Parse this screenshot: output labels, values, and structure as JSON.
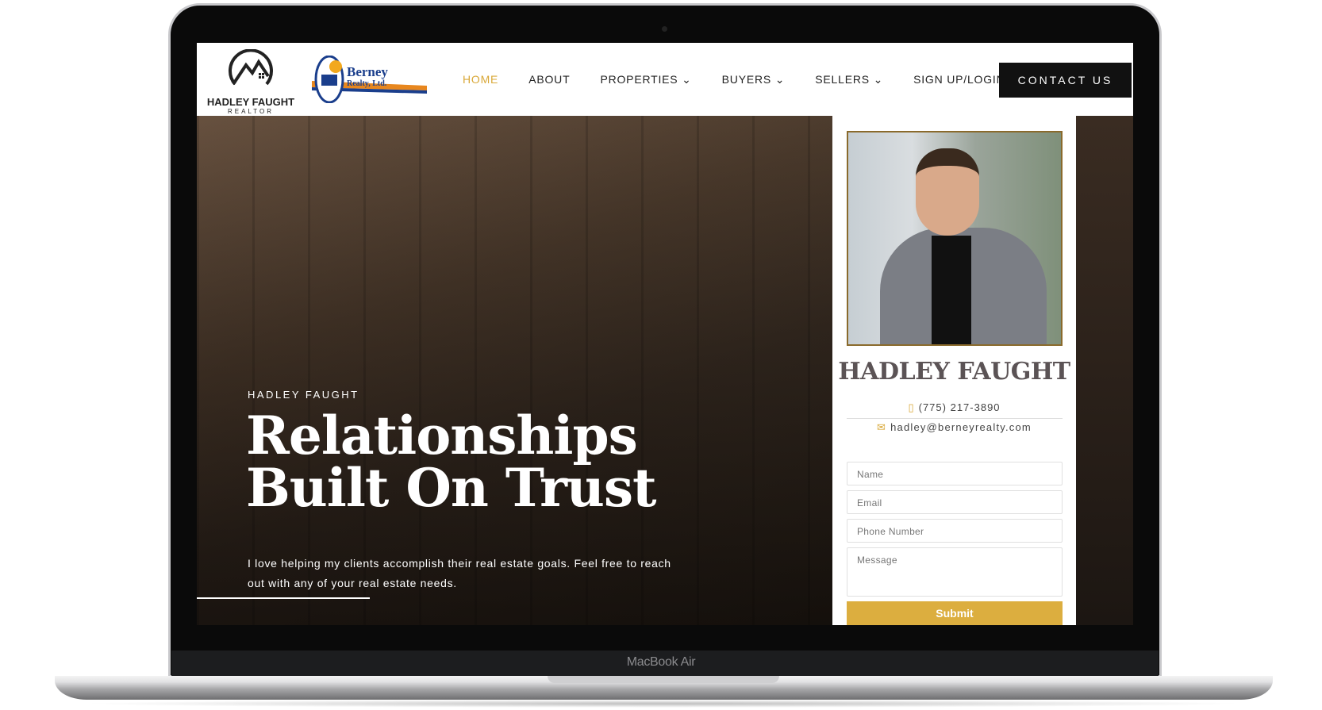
{
  "device": {
    "brand_label": "MacBook Air"
  },
  "logos": {
    "hadley": "HADLEY FAUGHT",
    "hadley_sub": "REALTOR",
    "berney_line1": "Berney",
    "berney_line2": "Realty, Ltd."
  },
  "nav": {
    "items": [
      {
        "label": "HOME",
        "active": true
      },
      {
        "label": "ABOUT"
      },
      {
        "label": "PROPERTIES ⌄"
      },
      {
        "label": "BUYERS ⌄"
      },
      {
        "label": "SELLERS ⌄"
      },
      {
        "label": "SIGN UP/LOGIN"
      }
    ],
    "cta": "CONTACT US",
    "accent": "#d9a838"
  },
  "hero": {
    "eyebrow": "HADLEY FAUGHT",
    "headline_1": "Relationships",
    "headline_2": "Built On Trust",
    "text": "I love helping my clients accomplish their real estate goals. Feel free to reach out with any of your real estate needs."
  },
  "agent": {
    "name": "HADLEY FAUGHT",
    "phone": "(775) 217-3890",
    "email": "hadley@berneyrealty.com"
  },
  "form": {
    "name_placeholder": "Name",
    "email_placeholder": "Email",
    "phone_placeholder": "Phone Number",
    "message_placeholder": "Message",
    "submit": "Submit",
    "submit_color": "#dcae3f"
  }
}
